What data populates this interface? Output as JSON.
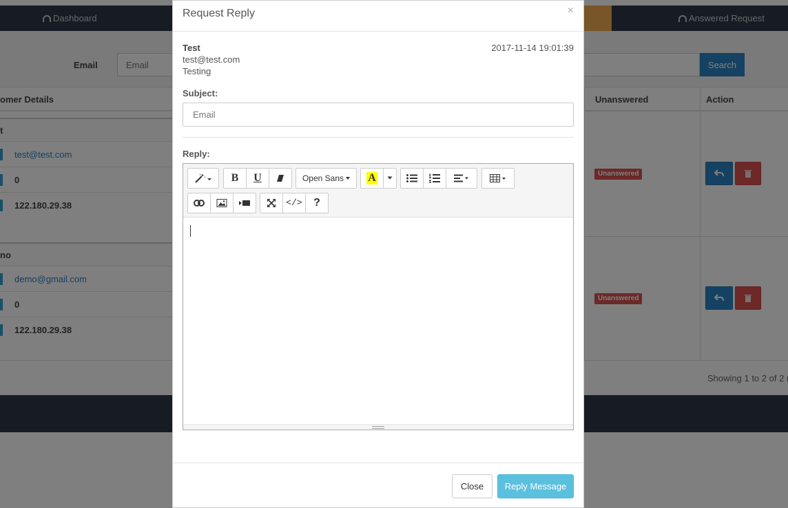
{
  "nav": {
    "dashboard": "Dashboard",
    "answered": "Answered Request"
  },
  "filter": {
    "label": "Email",
    "placeholder": "Email",
    "search": "Search"
  },
  "table": {
    "headers": {
      "details": "omer Details",
      "unanswered": "Unanswered",
      "action": "Action"
    },
    "rows": [
      {
        "name": "t",
        "email": "test@test.com",
        "count": "0",
        "ip": "122.180.29.38",
        "status": "Unanswered"
      },
      {
        "name": "no",
        "email": "demo@gmail.com",
        "count": "0",
        "ip": "122.180.29.38",
        "status": "Unanswered"
      }
    ],
    "showing": "Showing 1 to 2 of 2 ("
  },
  "modal": {
    "title": "Request Reply",
    "close_x": "×",
    "message": {
      "name": "Test",
      "email": "test@test.com",
      "text": "Testing",
      "date": "2017-11-14 19:01:39"
    },
    "subject_label": "Subject:",
    "subject_placeholder": "Email",
    "reply_label": "Reply:",
    "toolbar": {
      "font": "Open Sans",
      "bold": "B",
      "underline": "U",
      "color": "A",
      "help": "?",
      "code": "</>"
    },
    "buttons": {
      "close": "Close",
      "send": "Reply Message"
    }
  },
  "colors": {
    "nav_bg": "#2f3848",
    "primary": "#2a84c4",
    "danger": "#d9534f",
    "info": "#5bc0de",
    "active_tab": "#f0ad4e"
  }
}
